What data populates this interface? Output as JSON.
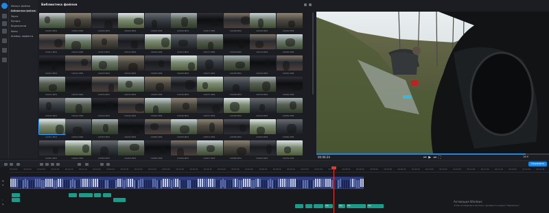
{
  "library": {
    "title": "Библиотека файлов",
    "thumbnails": [
      "C0001.MP4",
      "C0002.MP4",
      "C0003.MP4",
      "C0004.MP4",
      "C0005.MP4",
      "C0006.MP4",
      "C0007.MP4",
      "C0008.MP4",
      "C0009.MP4",
      "C0010.MP4",
      "C0011.MP4",
      "C0012.MP4",
      "C0013.MP4",
      "C0014.MP4",
      "C0015.MP4",
      "C0016.MP4",
      "C0017.MP4",
      "C0018.MP4",
      "C0019.MP4",
      "C0020.MP4",
      "C0021.MP4",
      "C0022.MP4",
      "C0023.MP4",
      "C0024.MP4",
      "C0025.MP4",
      "C0026.MP4",
      "C0027.MP4",
      "C0028.MP4",
      "C0029.MP4",
      "C0030.MP4",
      "C0031.MP4",
      "C0032.MP4",
      "C0033.MP4",
      "C0034.MP4",
      "C0035.MP4",
      "C0036.MP4",
      "C0037.MP4",
      "C0038.MP4",
      "C0039.MP4",
      "C0040.MP4",
      "C0041.MP4",
      "C0042.MP4",
      "C0043.MP4",
      "C0044.MP4",
      "C0045.MP4",
      "C0046.MP4",
      "C0047.MP4",
      "C0048.MP4",
      "C0049.MP4",
      "C0050.MP4",
      "C0051.MP4",
      "C0052.MP4",
      "C0053.MP4",
      "C0054.MP4",
      "C0055.MP4",
      "C0056.MP4",
      "C0057.MP4",
      "C0058.MP4",
      "C0059.MP4",
      "C0060.MP4",
      "C0061.MP4",
      "C0062.MP4",
      "C0063.MP4",
      "C0064.MP4",
      "C0065.MP4",
      "C0066.MP4",
      "C0067.MP4",
      "C0068.MP4",
      "C0069.MP4",
      "C0070.MP4"
    ],
    "selected_index": 50
  },
  "menu": {
    "items": [
      "Импорт файлов",
      "Библиотека файлов",
      "Звуки",
      "Музыка",
      "Видеоклипы",
      "Фоны",
      "Анимир. эффекты"
    ],
    "active_index": 1
  },
  "player": {
    "timecode": "00:00:24",
    "zoom": "16:9",
    "progress": 0.9
  },
  "toolbar": {
    "export_label": "Сохранить"
  },
  "timeline": {
    "ruler": [
      "00:00:00",
      "00:00:20",
      "00:00:40",
      "00:01:00",
      "00:01:20",
      "00:01:40",
      "00:02:00",
      "00:02:20",
      "00:02:40",
      "00:03:00",
      "00:03:20",
      "00:03:40",
      "00:04:00",
      "00:04:20",
      "00:04:40",
      "00:05:00",
      "00:05:20",
      "00:05:40",
      "00:06:00",
      "00:06:20",
      "00:06:40",
      "00:07:00",
      "00:07:20",
      "00:07:40",
      "00:08:00",
      "00:08:20",
      "00:08:40",
      "00:09:00",
      "00:09:20",
      "00:09:40",
      "00:10:00",
      "00:10:20",
      "00:10:40",
      "00:11:00",
      "00:11:20",
      "00:11:40",
      "00:12:00",
      "00:12:20",
      "00:12:40"
    ],
    "audio_labels": [
      "Clip",
      "Clip",
      "Clip",
      "Clip"
    ]
  },
  "watermark": {
    "title": "Активация Windows",
    "subtitle": "Чтобы активировать Windows, перейдите в раздел \"Параметры\"."
  },
  "colors": {
    "accent": "#1e88e5",
    "playhead": "#e53935",
    "audio_clip": "#1d9b8a",
    "video_track": "#2c3c7a"
  }
}
